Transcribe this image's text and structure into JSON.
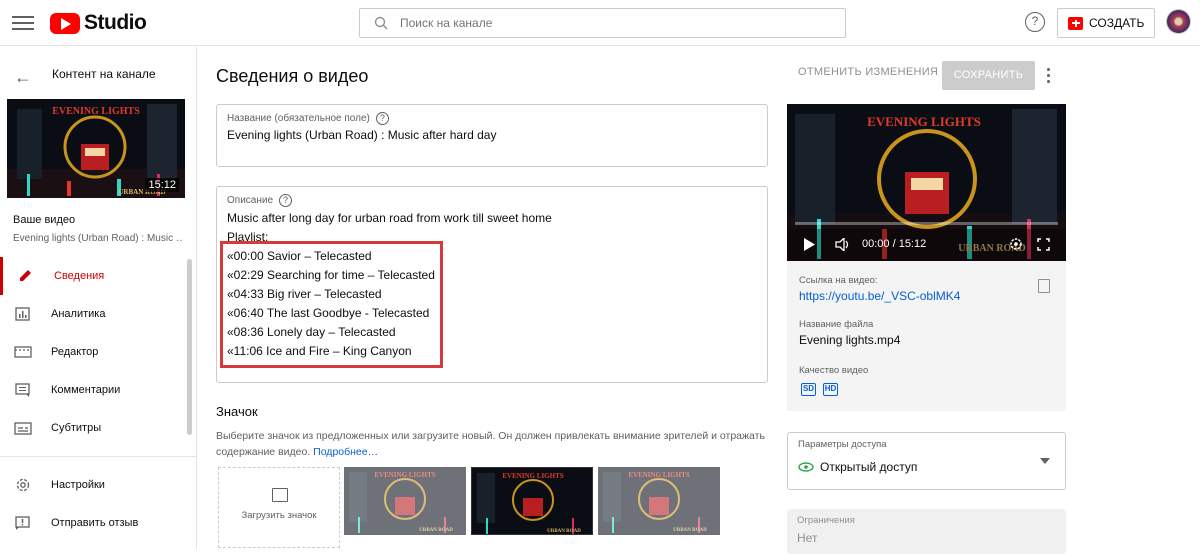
{
  "header": {
    "logo_text": "Studio",
    "search_placeholder": "Поиск на канале",
    "help_symbol": "?",
    "create_label": "СОЗДАТЬ"
  },
  "sidebar": {
    "back_symbol": "←",
    "title": "Контент на канале",
    "thumbnail_duration": "15:12",
    "your_video_label": "Ваше видео",
    "your_video_title": "Evening lights (Urban Road) : Music …",
    "items": [
      {
        "label": "Сведения",
        "icon": "pencil-icon",
        "active": true
      },
      {
        "label": "Аналитика",
        "icon": "analytics-icon"
      },
      {
        "label": "Редактор",
        "icon": "editor-icon"
      },
      {
        "label": "Комментарии",
        "icon": "comments-icon"
      },
      {
        "label": "Субтитры",
        "icon": "subtitles-icon"
      }
    ],
    "bottom_items": [
      {
        "label": "Настройки",
        "icon": "gear-icon"
      },
      {
        "label": "Отправить отзыв",
        "icon": "feedback-icon"
      }
    ]
  },
  "main": {
    "title": "Сведения о видео",
    "undo_label": "ОТМЕНИТЬ ИЗМЕНЕНИЯ",
    "save_label": "СОХРАНИТЬ",
    "title_field": {
      "label": "Название (обязательное поле)",
      "value": "Evening lights (Urban Road) : Music after hard day"
    },
    "description_field": {
      "label": "Описание",
      "lines": [
        "Music after long day for urban road from work till sweet home",
        "Playlist:",
        "«00:00 Savior – Telecasted",
        "«02:29 Searching for time – Telecasted",
        "«04:33 Big river – Telecasted",
        "«06:40 The last Goodbye - Telecasted",
        "«08:36 Lonely day – Telecasted",
        "«11:06 Ice and Fire –  King Canyon"
      ]
    },
    "thumbnail_section": {
      "title": "Значок",
      "description": "Выберите значок из предложенных или загрузите новый. Он должен привлекать внимание зрителей и отражать содержание видео.",
      "more_link": "Подробнее…",
      "upload_label": "Загрузить значок"
    }
  },
  "video_panel": {
    "time": "00:00 / 15:12",
    "link_label": "Ссылка на видео:",
    "link_value": "https://youtu.be/_VSC-oblMK4",
    "filename_label": "Название файла",
    "filename_value": "Evening lights.mp4",
    "quality_label": "Качество видео",
    "quality_badges": [
      "SD",
      "HD"
    ],
    "access_label": "Параметры доступа",
    "access_value": "Открытый доступ",
    "restrictions_label": "Ограничения",
    "restrictions_value": "Нет"
  },
  "thumbnail_art": {
    "title_text": "EVENING LIGHTS",
    "subtitle_text": "URBAN ROAD"
  },
  "colors": {
    "accent_red": "#cc0000",
    "highlight_box": "#d63a3a",
    "link_blue": "#065fd4",
    "access_green": "#2ba640"
  }
}
